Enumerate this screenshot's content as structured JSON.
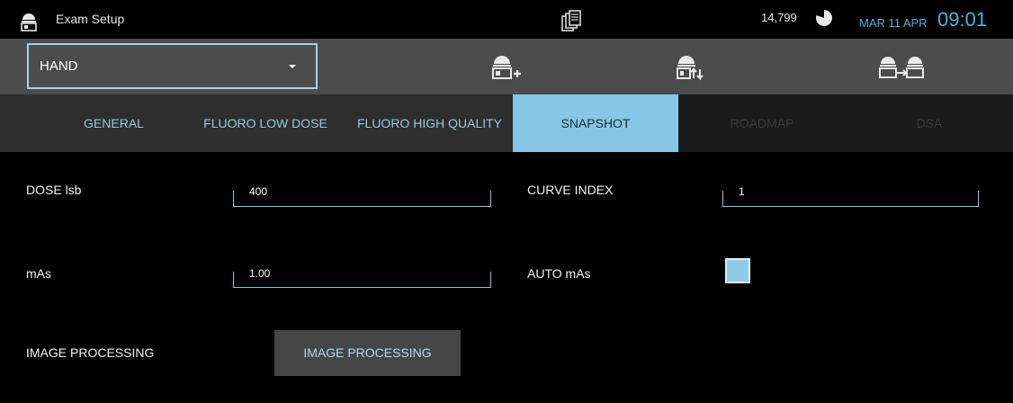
{
  "header": {
    "title": "Exam Setup",
    "counter": "14,799",
    "date": "MAR 11 APR",
    "time": "09:01",
    "icons": [
      "user-badge-icon",
      "copies-icon",
      "pie-icon"
    ]
  },
  "toolbar": {
    "protocol_value": "HAND",
    "buttons": [
      "add-patient-icon",
      "patient-sort-icon",
      "patient-transfer-icon"
    ]
  },
  "tabs": [
    {
      "label": "GENERAL",
      "state": "normal"
    },
    {
      "label": "FLUORO LOW DOSE",
      "state": "normal"
    },
    {
      "label": "FLUORO HIGH QUALITY",
      "state": "normal"
    },
    {
      "label": "SNAPSHOT",
      "state": "active"
    },
    {
      "label": "ROADMAP",
      "state": "disabled"
    },
    {
      "label": "DSA",
      "state": "disabled"
    }
  ],
  "form": {
    "dose_label": "DOSE lsb",
    "dose_value": "400",
    "curve_label": "CURVE INDEX",
    "curve_value": "1",
    "mas_label": "mAs",
    "mas_value": "1.00",
    "auto_mas_label": "AUTO mAs",
    "auto_mas_checked": true,
    "image_processing_label": "IMAGE PROCESSING",
    "image_processing_button": "IMAGE PROCESSING"
  },
  "colors": {
    "accent": "#86c6e6",
    "text_blue": "#4fb1dd"
  }
}
